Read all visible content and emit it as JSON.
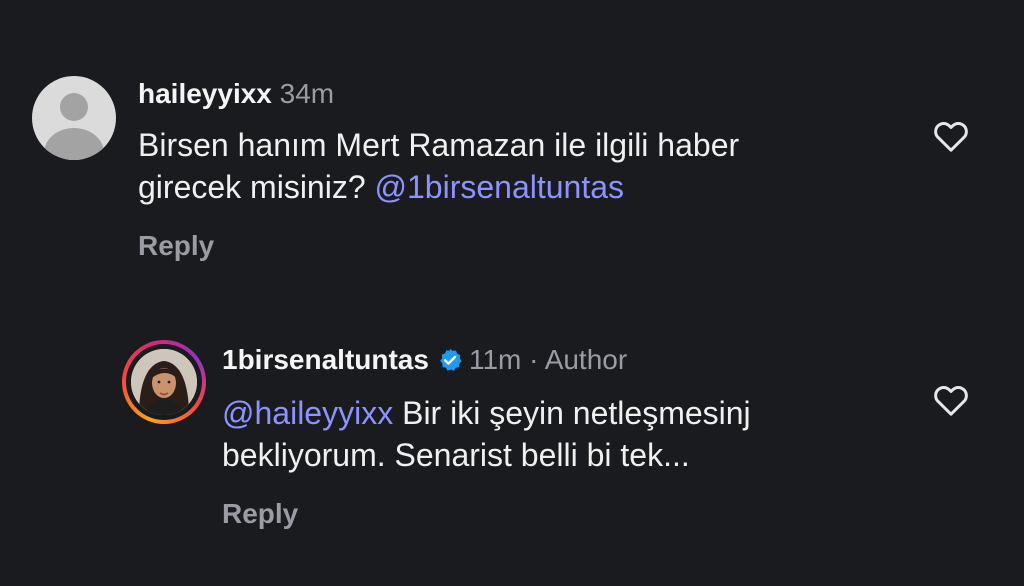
{
  "comments": [
    {
      "username": "haileyyixx",
      "time": "34m",
      "text_line1": "Birsen hanım Mert Ramazan ile ilgili haber",
      "text_line2_prefix": "girecek misiniz? ",
      "mention": "@1birsenaltuntas",
      "reply_label": "Reply"
    },
    {
      "username": "1birsenaltuntas",
      "verified": true,
      "time": "11m",
      "separator": "·",
      "author_label": "Author",
      "mention": "@haileyyixx",
      "text_line1_suffix": " Bir iki şeyin netleşmesinj",
      "text_line2": "bekliyorum. Senarist belli bi tek...",
      "reply_label": "Reply"
    }
  ],
  "colors": {
    "background": "#1a1b1f",
    "mention": "#8b93ff",
    "muted": "#9a9ca3",
    "verified": "#1d9bf0"
  },
  "icons": {
    "like": "heart-outline-icon",
    "verified": "verified-badge-icon"
  }
}
